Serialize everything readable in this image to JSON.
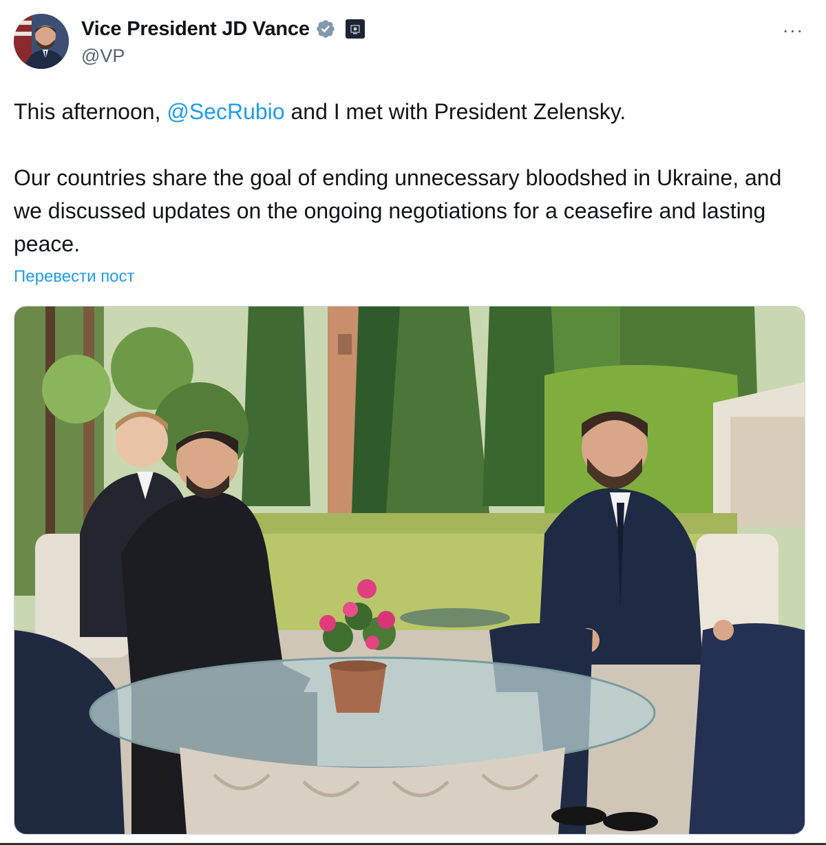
{
  "author": {
    "display_name": "Vice President JD Vance",
    "handle": "@VP",
    "verified_icon": "verified-badge-icon",
    "affiliation_icon": "government-affiliation-icon"
  },
  "menu": {
    "more_label": "···"
  },
  "post": {
    "line1_before": "This afternoon, ",
    "line1_mention": "@SecRubio",
    "line1_after": " and I met with President Zelensky.",
    "paragraph2": "Our countries share the goal of ending unnecessary bloodshed in Ukraine, and we discussed updates on the ongoing negotiations for a ceasefire and lasting peace.",
    "translate_label": "Перевести пост"
  },
  "colors": {
    "text": "#0f1419",
    "secondary": "#536471",
    "link": "#1d9bf0",
    "border": "#cfd9de"
  }
}
